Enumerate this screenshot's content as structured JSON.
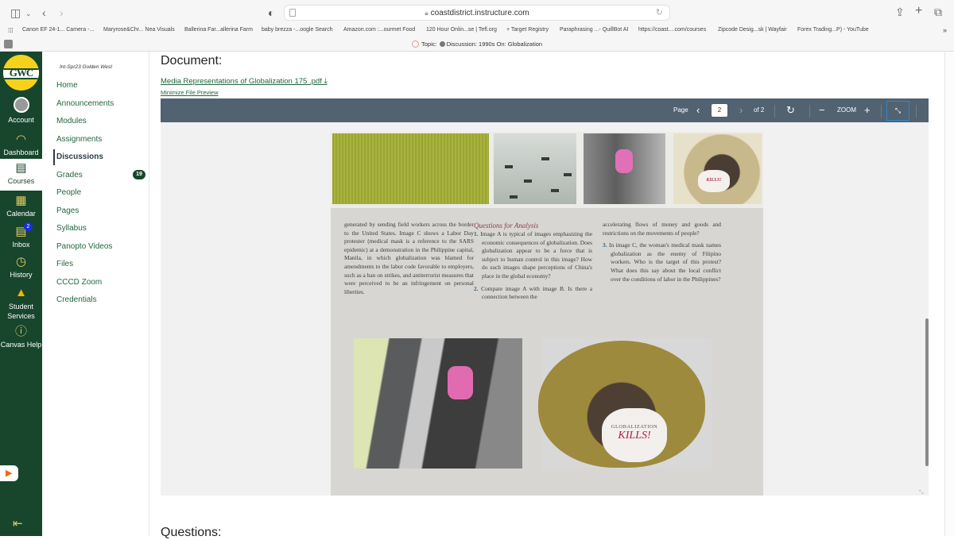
{
  "browser": {
    "url": "coastdistrict.instructure.com",
    "bookmarks": [
      "Canon EF 24-1... Camera -...",
      "Maryrose&Chr... Nea Visuals",
      "Ballerina Far...allerina Farm",
      "baby brezza -...oogle Search",
      "Amazon.com :...ourmet Food",
      "120 Hour Onlin...se | Tefl.org",
      "+ Target Registry",
      "Paraphrasing ...- QuillBot AI",
      "https://coast....com/courses",
      "Zipcode Desig...sk | Wayfair",
      "Forex Trading...P) - YouTube"
    ],
    "tab_label": "Topic:",
    "tab_title": "Discussion: 1990s On: Globalization",
    "more_bookmarks": "»"
  },
  "global_nav": {
    "logo_text": "GWC",
    "items": [
      {
        "label": "Account"
      },
      {
        "label": "Dashboard"
      },
      {
        "label": "Courses"
      },
      {
        "label": "Calendar"
      },
      {
        "label": "Inbox",
        "badge": "2"
      },
      {
        "label": "History"
      },
      {
        "label": "Student Services"
      },
      {
        "label": "Canvas Help"
      }
    ]
  },
  "course_nav": {
    "term": "Int-Spr23 Golden West",
    "items": [
      {
        "label": "Home"
      },
      {
        "label": "Announcements"
      },
      {
        "label": "Modules"
      },
      {
        "label": "Assignments"
      },
      {
        "label": "Discussions",
        "active": true
      },
      {
        "label": "Grades",
        "badge": "19"
      },
      {
        "label": "People"
      },
      {
        "label": "Pages"
      },
      {
        "label": "Syllabus"
      },
      {
        "label": "Panopto Videos"
      },
      {
        "label": "Files"
      },
      {
        "label": "CCCD Zoom"
      },
      {
        "label": "Credentials"
      }
    ]
  },
  "main": {
    "document_heading": "Document:",
    "file_link": "Media Representations of Globalization 175 .pdf",
    "minimize_link": "Minimize File Preview",
    "questions_heading": "Questions:"
  },
  "viewer": {
    "page_label": "Page",
    "current_page": "2",
    "total_pages": "of 2",
    "zoom_label": "ZOOM"
  },
  "pdf": {
    "col1": "generated by sending field workers across the border to the United States. Image C shows a Labor Day protester (medical mask is a reference to the SARS epidemic) at a demonstration in the Philippine capital, Manila, in which globalization was blamed for amendments to the labor code favorable to employers, such as a ban on strikes, and antiterrorist measures that were perceived to be an infringement on personal liberties.",
    "questions_title": "Questions for Analysis",
    "q1_num": "1.",
    "q1": "Image A is typical of images emphasizing the economic consequences of globalization. Does globalization appear to be a force that is subject to human control in this image? How do such images shape perceptions of China's place in the global economy?",
    "q2_num": "2.",
    "q2": "Compare image A with image B. Is there a connection between the",
    "col3_cont": "accelerating flows of money and goods and restrictions on the movements of people?",
    "q3_num": "3.",
    "q3": "In image C, the woman's medical mask names globalization as the enemy of Filipino workers. Who is the target of this protest? What does this say about the local conflict over the conditions of labor in the Philippines?",
    "mask_line1": "GLOBALIZATION",
    "mask_line2": "KILLS!",
    "mask_small": "KILLS!"
  }
}
